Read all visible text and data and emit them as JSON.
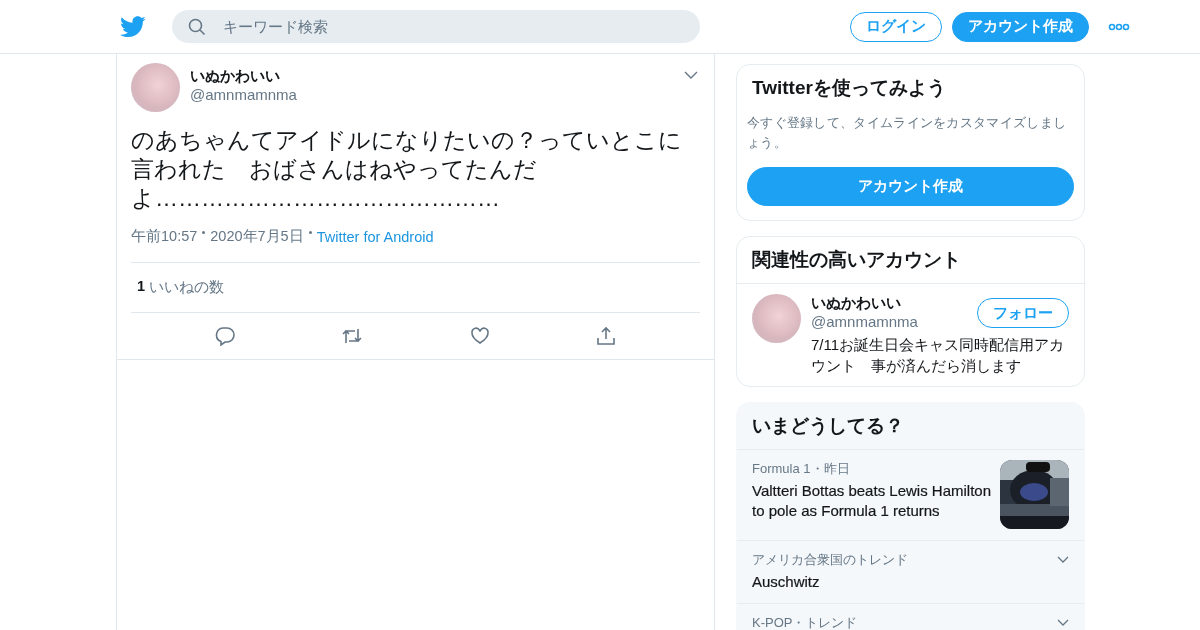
{
  "header": {
    "search": {
      "placeholder": "キーワード検索"
    },
    "login": "ログイン",
    "signup": "アカウント作成"
  },
  "tweet": {
    "author": {
      "name": "いぬかわいい",
      "handle": "@amnmamnma"
    },
    "text": "のあちゃんてアイドルになりたいの？っていとこに言われた　おばさんはねやってたんだよ………………………………………",
    "time": "午前10:57",
    "date": "2020年7月5日",
    "source": "Twitter for Android",
    "likes": {
      "count": "1",
      "label": "いいねの数"
    }
  },
  "signup_card": {
    "title": "Twitterを使ってみよう",
    "text": "今すぐ登録して、タイムラインをカスタマイズしましょう。",
    "button": "アカウント作成"
  },
  "related": {
    "title": "関連性の高いアカウント",
    "accounts": [
      {
        "name": "いぬかわいい",
        "handle": "@amnmamnma",
        "bio": "7/11お誕生日会キャス同時配信用アカウント　事が済んだら消します",
        "follow": "フォロー"
      }
    ]
  },
  "trends": {
    "title": "いまどうしてる？",
    "items": [
      {
        "kind": "news",
        "category": "Formula 1・昨日",
        "title": "Valtteri Bottas beats Lewis Hamilton to pole as Formula 1 returns"
      },
      {
        "kind": "trend",
        "category": "アメリカ合衆国のトレンド",
        "title": "Auschwitz"
      },
      {
        "kind": "trend",
        "category": "K-POP・トレンド"
      }
    ]
  }
}
